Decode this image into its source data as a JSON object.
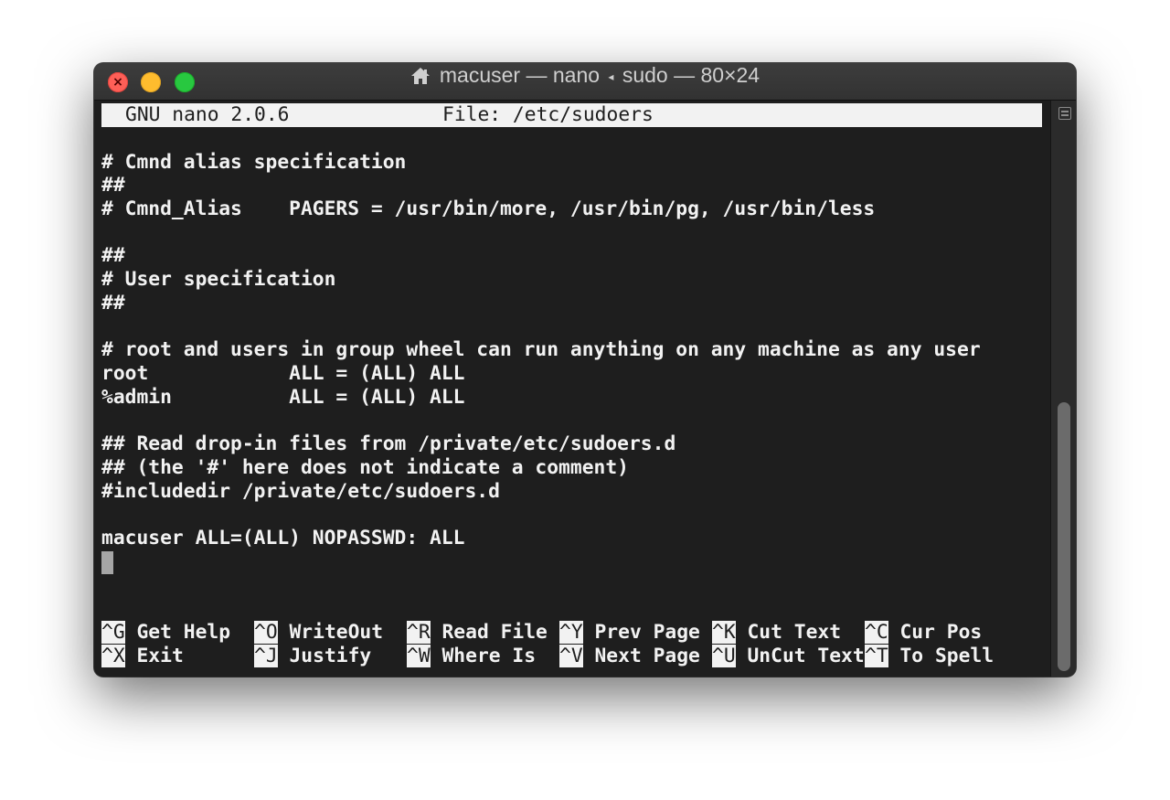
{
  "window": {
    "title_user": "macuser",
    "title_rest1": " — nano ",
    "title_arrow": "◂",
    "title_rest2": " sudo — 80×24"
  },
  "nano": {
    "version": "GNU nano 2.0.6",
    "file_label": "File: /etc/sudoers"
  },
  "file_lines": [
    "",
    "# Cmnd alias specification",
    "##",
    "# Cmnd_Alias    PAGERS = /usr/bin/more, /usr/bin/pg, /usr/bin/less",
    "",
    "##",
    "# User specification",
    "##",
    "",
    "# root and users in group wheel can run anything on any machine as any user",
    "root            ALL = (ALL) ALL",
    "%admin          ALL = (ALL) ALL",
    "",
    "## Read drop-in files from /private/etc/sudoers.d",
    "## (the '#' here does not indicate a comment)",
    "#includedir /private/etc/sudoers.d",
    "",
    "macuser ALL=(ALL) NOPASSWD: ALL"
  ],
  "shortcuts": [
    {
      "key": "^G",
      "label": " Get Help"
    },
    {
      "key": "^O",
      "label": " WriteOut"
    },
    {
      "key": "^R",
      "label": " Read File"
    },
    {
      "key": "^Y",
      "label": " Prev Page"
    },
    {
      "key": "^K",
      "label": " Cut Text"
    },
    {
      "key": "^C",
      "label": " Cur Pos"
    },
    {
      "key": "^X",
      "label": " Exit"
    },
    {
      "key": "^J",
      "label": " Justify"
    },
    {
      "key": "^W",
      "label": " Where Is"
    },
    {
      "key": "^V",
      "label": " Next Page"
    },
    {
      "key": "^U",
      "label": " UnCut Text"
    },
    {
      "key": "^T",
      "label": " To Spell"
    }
  ],
  "icons": {
    "title": "home-icon",
    "scroll": "scroll-split-icon"
  }
}
